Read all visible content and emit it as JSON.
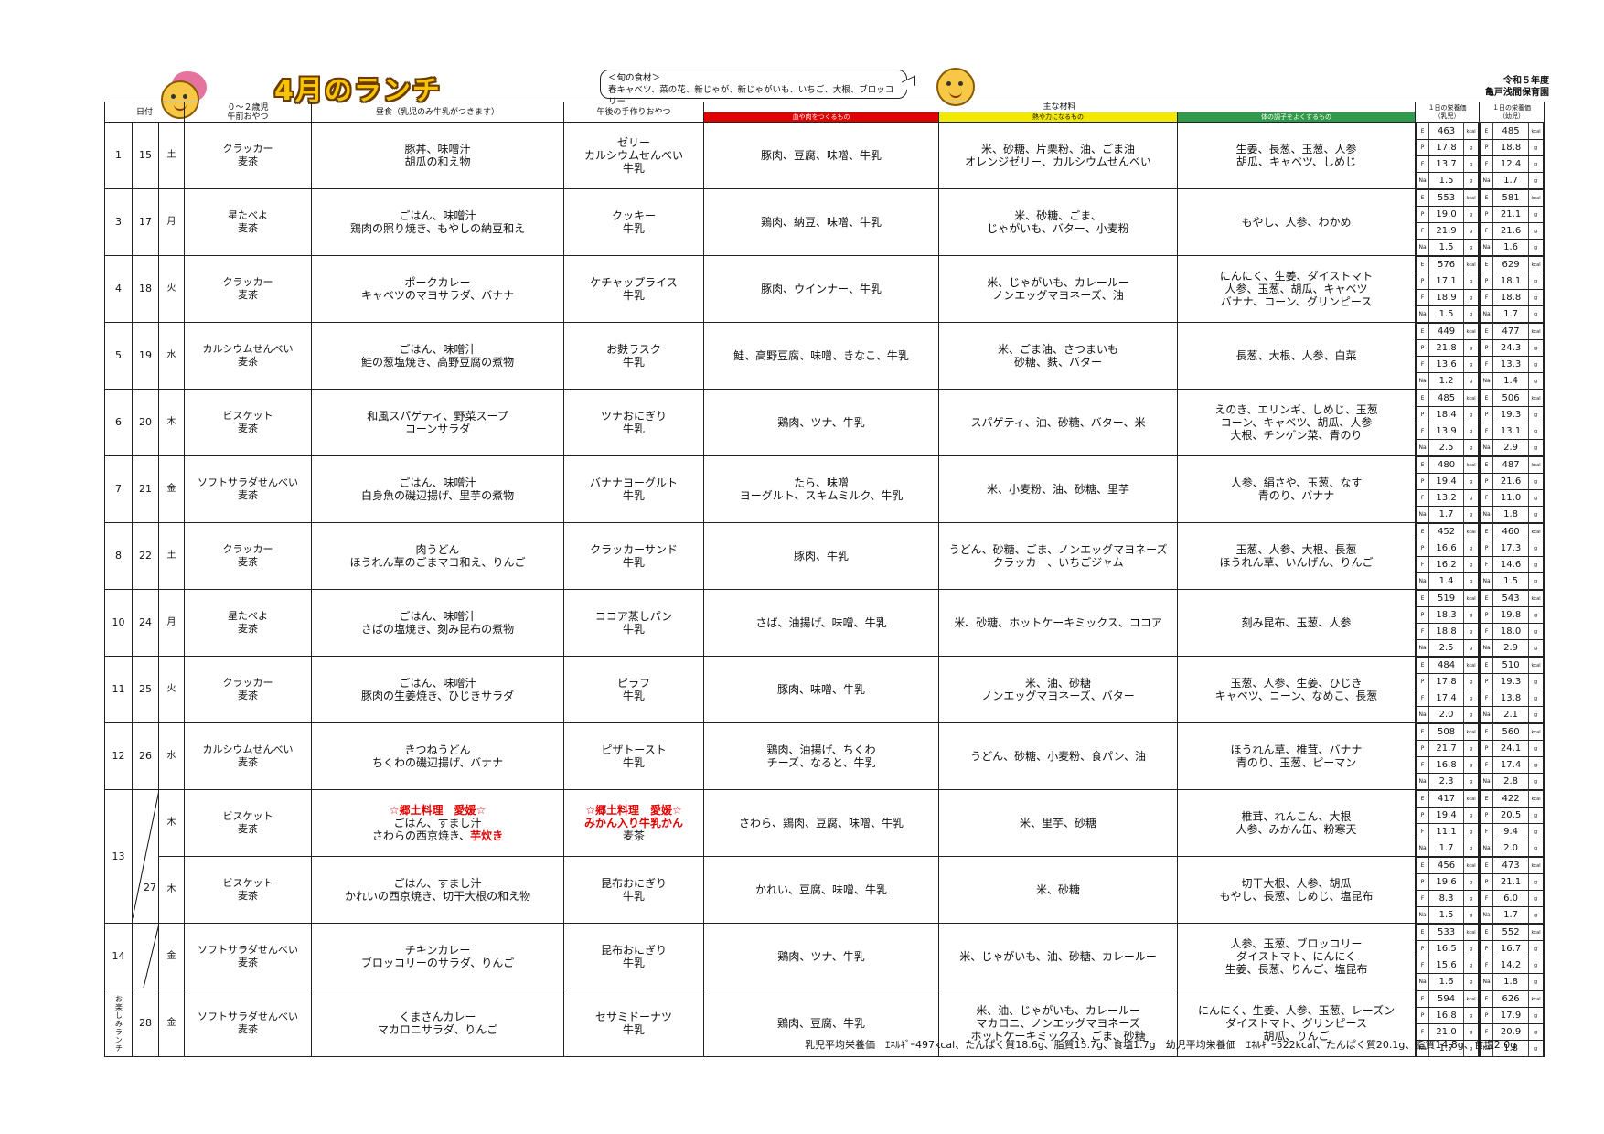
{
  "header": {
    "title": "4月のランチ",
    "seasonal_label": "＜旬の食材＞",
    "seasonal_items": "春キャベツ、菜の花、新じゃが、新じゃがいも、いちご、大根、ブロッコリー",
    "org_year": "令和５年度",
    "org_name": "亀戸浅間保育園"
  },
  "columns": {
    "date": "日付",
    "morning_snack": "０～２歳児\n午前おやつ",
    "lunch": "昼食（乳児のみ牛乳がつきます）",
    "pm_snack": "午後の手作りおやつ",
    "ingredients": "主な材料",
    "red": "血や肉をつくるもの",
    "yellow": "熱や力になるもの",
    "green": "体の調子をよくするもの",
    "nut_infant": "１日の栄養価\n（乳児）",
    "nut_toddler": "１日の栄養価\n（幼児）"
  },
  "nutrition_keys": [
    "E",
    "P",
    "F",
    "Na"
  ],
  "nutrition_units": [
    "kcal",
    "g",
    "g",
    "g"
  ],
  "side_label": "お楽しみランチ",
  "rows": [
    {
      "a": "1",
      "b": "15",
      "dow": "土",
      "snack": "クラッカー\n麦茶",
      "lunch": "豚丼、味噌汁\n胡瓜の和え物",
      "pm": "ゼリー\nカルシウムせんべい\n牛乳",
      "red": "豚肉、豆腐、味噌、牛乳",
      "yellow": "米、砂糖、片栗粉、油、ごま油\nオレンジゼリー、カルシウムせんべい",
      "green": "生姜、長葱、玉葱、人参\n胡瓜、キャベツ、しめじ",
      "inf": [
        "463",
        "17.8",
        "13.7",
        "1.5"
      ],
      "tod": [
        "485",
        "18.8",
        "12.4",
        "1.7"
      ]
    },
    {
      "a": "3",
      "b": "17",
      "dow": "月",
      "snack": "星たべよ\n麦茶",
      "lunch": "ごはん、味噌汁\n鶏肉の照り焼き、もやしの納豆和え",
      "pm": "クッキー\n牛乳",
      "red": "鶏肉、納豆、味噌、牛乳",
      "yellow": "米、砂糖、ごま、\nじゃがいも、バター、小麦粉",
      "green": "もやし、人参、わかめ",
      "inf": [
        "553",
        "19.0",
        "21.9",
        "1.5"
      ],
      "tod": [
        "581",
        "21.1",
        "21.6",
        "1.6"
      ]
    },
    {
      "a": "4",
      "b": "18",
      "dow": "火",
      "snack": "クラッカー\n麦茶",
      "lunch": "ポークカレー\nキャベツのマヨサラダ、バナナ",
      "pm": "ケチャップライス\n牛乳",
      "red": "豚肉、ウインナー、牛乳",
      "yellow": "米、じゃがいも、カレールー\nノンエッグマヨネーズ、油",
      "green": "にんにく、生姜、ダイストマト\n人参、玉葱、胡瓜、キャベツ\nバナナ、コーン、グリンピース",
      "inf": [
        "576",
        "17.1",
        "18.9",
        "1.5"
      ],
      "tod": [
        "629",
        "18.1",
        "18.8",
        "1.7"
      ]
    },
    {
      "a": "5",
      "b": "19",
      "dow": "水",
      "snack": "カルシウムせんべい\n麦茶",
      "lunch": "ごはん、味噌汁\n鮭の葱塩焼き、高野豆腐の煮物",
      "pm": "お麩ラスク\n牛乳",
      "red": "鮭、高野豆腐、味噌、きなこ、牛乳",
      "yellow": "米、ごま油、さつまいも\n砂糖、麩、バター",
      "green": "長葱、大根、人参、白菜",
      "inf": [
        "449",
        "21.8",
        "13.6",
        "1.2"
      ],
      "tod": [
        "477",
        "24.3",
        "13.3",
        "1.4"
      ]
    },
    {
      "a": "6",
      "b": "20",
      "dow": "木",
      "snack": "ビスケット\n麦茶",
      "lunch": "和風スパゲティ、野菜スープ\nコーンサラダ",
      "pm": "ツナおにぎり\n牛乳",
      "red": "鶏肉、ツナ、牛乳",
      "yellow": "スパゲティ、油、砂糖、バター、米",
      "green": "えのき、エリンギ、しめじ、玉葱\nコーン、キャベツ、胡瓜、人参\n大根、チンゲン菜、青のり",
      "inf": [
        "485",
        "18.4",
        "13.9",
        "2.5"
      ],
      "tod": [
        "506",
        "19.3",
        "13.1",
        "2.9"
      ]
    },
    {
      "a": "7",
      "b": "21",
      "dow": "金",
      "snack": "ソフトサラダせんべい\n麦茶",
      "lunch": "ごはん、味噌汁\n白身魚の磯辺揚げ、里芋の煮物",
      "pm": "バナナヨーグルト\n牛乳",
      "red": "たら、味噌\nヨーグルト、スキムミルク、牛乳",
      "yellow": "米、小麦粉、油、砂糖、里芋",
      "green": "人参、絹さや、玉葱、なす\n青のり、バナナ",
      "inf": [
        "480",
        "19.4",
        "13.2",
        "1.7"
      ],
      "tod": [
        "487",
        "21.6",
        "11.0",
        "1.8"
      ]
    },
    {
      "a": "8",
      "b": "22",
      "dow": "土",
      "snack": "クラッカー\n麦茶",
      "lunch": "肉うどん\nほうれん草のごまマヨ和え、りんご",
      "pm": "クラッカーサンド\n牛乳",
      "red": "豚肉、牛乳",
      "yellow": "うどん、砂糖、ごま、ノンエッグマヨネーズ\nクラッカー、いちごジャム",
      "green": "玉葱、人参、大根、長葱\nほうれん草、いんげん、りんご",
      "inf": [
        "452",
        "16.6",
        "16.2",
        "1.4"
      ],
      "tod": [
        "460",
        "17.3",
        "14.6",
        "1.5"
      ]
    },
    {
      "a": "10",
      "b": "24",
      "dow": "月",
      "snack": "星たべよ\n麦茶",
      "lunch": "ごはん、味噌汁\nさばの塩焼き、刻み昆布の煮物",
      "pm": "ココア蒸しパン\n牛乳",
      "red": "さば、油揚げ、味噌、牛乳",
      "yellow": "米、砂糖、ホットケーキミックス、ココア",
      "green": "刻み昆布、玉葱、人参",
      "inf": [
        "519",
        "18.3",
        "18.8",
        "2.5"
      ],
      "tod": [
        "543",
        "19.8",
        "18.0",
        "2.9"
      ]
    },
    {
      "a": "11",
      "b": "25",
      "dow": "火",
      "snack": "クラッカー\n麦茶",
      "lunch": "ごはん、味噌汁\n豚肉の生姜焼き、ひじきサラダ",
      "pm": "ピラフ\n牛乳",
      "red": "豚肉、味噌、牛乳",
      "yellow": "米、油、砂糖\nノンエッグマヨネーズ、バター",
      "green": "玉葱、人参、生姜、ひじき\nキャベツ、コーン、なめこ、長葱",
      "inf": [
        "484",
        "17.8",
        "17.4",
        "2.0"
      ],
      "tod": [
        "510",
        "19.3",
        "13.8",
        "2.1"
      ]
    },
    {
      "a": "12",
      "b": "26",
      "dow": "水",
      "snack": "カルシウムせんべい\n麦茶",
      "lunch": "きつねうどん\nちくわの磯辺揚げ、バナナ",
      "pm": "ピザトースト\n牛乳",
      "red": "鶏肉、油揚げ、ちくわ\nチーズ、なると、牛乳",
      "yellow": "うどん、砂糖、小麦粉、食パン、油",
      "green": "ほうれん草、椎茸、バナナ\n青のり、玉葱、ピーマン",
      "inf": [
        "508",
        "21.7",
        "16.8",
        "2.3"
      ],
      "tod": [
        "560",
        "24.1",
        "17.4",
        "2.8"
      ]
    },
    {
      "a": "13",
      "b": "",
      "dow": "木",
      "snack": "ビスケット\n麦茶",
      "lunch_special": "☆郷土料理　愛媛☆",
      "lunch": "ごはん、すまし汁",
      "lunch_l3a": "さわらの西京焼き、",
      "lunch_l3b": "芋炊き",
      "pm_special": "☆郷土料理　愛媛☆",
      "pm_special2": "みかん入り牛乳かん",
      "pm": "麦茶",
      "red": "さわら、鶏肉、豆腐、味噌、牛乳",
      "yellow": "米、里芋、砂糖",
      "green": "椎茸、れんこん、大根\n人参、みかん缶、粉寒天",
      "inf": [
        "417",
        "19.4",
        "11.1",
        "1.7"
      ],
      "tod": [
        "422",
        "20.5",
        "9.4",
        "2.0"
      ]
    },
    {
      "a": "",
      "b": "27",
      "dow": "木",
      "snack": "ビスケット\n麦茶",
      "lunch": "ごはん、すまし汁\nかれいの西京焼き、切干大根の和え物",
      "pm": "昆布おにぎり\n牛乳",
      "red": "かれい、豆腐、味噌、牛乳",
      "yellow": "米、砂糖",
      "green": "切干大根、人参、胡瓜\nもやし、長葱、しめじ、塩昆布",
      "inf": [
        "456",
        "19.6",
        "8.3",
        "1.5"
      ],
      "tod": [
        "473",
        "21.1",
        "6.0",
        "1.7"
      ]
    },
    {
      "a": "14",
      "b": "",
      "dow": "金",
      "snack": "ソフトサラダせんべい\n麦茶",
      "lunch": "チキンカレー\nブロッコリーのサラダ、りんご",
      "pm": "昆布おにぎり\n牛乳",
      "red": "鶏肉、ツナ、牛乳",
      "yellow": "米、じゃがいも、油、砂糖、カレールー",
      "green": "人参、玉葱、ブロッコリー\nダイストマト、にんにく\n生姜、長葱、りんご、塩昆布",
      "inf": [
        "533",
        "16.5",
        "15.6",
        "1.6"
      ],
      "tod": [
        "552",
        "16.7",
        "14.2",
        "1.8"
      ]
    },
    {
      "a": "",
      "b": "28",
      "dow": "金",
      "snack": "ソフトサラダせんべい\n麦茶",
      "lunch": "くまさんカレー\nマカロニサラダ、りんご",
      "pm": "セサミドーナツ\n牛乳",
      "red": "鶏肉、豆腐、牛乳",
      "yellow": "米、油、じゃがいも、カレールー\nマカロニ、ノンエッグマヨネーズ\nホットケーキミックス、ごま、砂糖",
      "green": "にんにく、生姜、人参、玉葱、レーズン\nダイストマト、グリンピース\n胡瓜、りんご",
      "inf": [
        "594",
        "16.8",
        "21.0",
        "1.7"
      ],
      "tod": [
        "626",
        "17.9",
        "20.9",
        "1.8"
      ]
    }
  ],
  "footer": "乳児平均栄養価　ｴﾈﾙｷﾞｰ497kcal、たんぱく質18.6g、脂質15.7g、食塩1.7g　幼児平均栄養価　ｴﾈﾙｷﾞｰ522kcal、たんぱく質20.1g、脂質14.8g、食塩2.0g"
}
